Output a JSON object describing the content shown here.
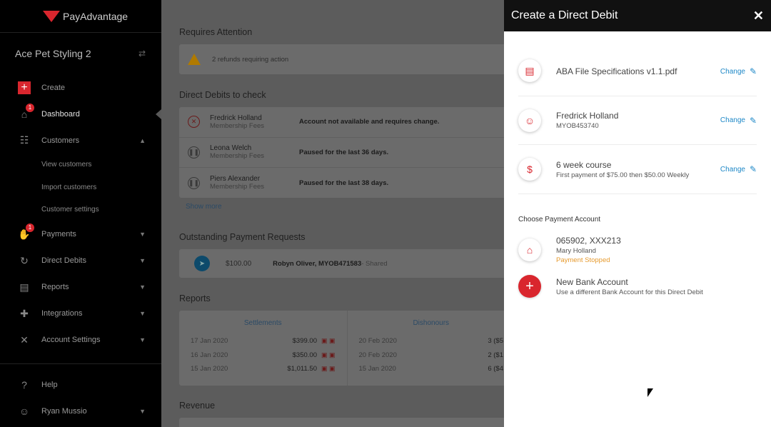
{
  "brand": "PayAdvantage",
  "account_name": "Ace Pet Styling 2",
  "nav": {
    "create": "Create",
    "dashboard": "Dashboard",
    "dashboard_badge": "1",
    "customers": "Customers",
    "customers_sub": [
      "View customers",
      "Import customers",
      "Customer settings"
    ],
    "payments": "Payments",
    "payments_badge": "1",
    "direct_debits": "Direct Debits",
    "reports": "Reports",
    "integrations": "Integrations",
    "account_settings": "Account Settings",
    "help": "Help",
    "user": "Ryan Mussio"
  },
  "main": {
    "requires_attention": "Requires Attention",
    "attention_text": "2 refunds requiring action",
    "dd_check_title": "Direct Debits to check",
    "dd_rows": [
      {
        "name": "Fredrick Holland",
        "plan": "Membership Fees",
        "message": "Account not available and requires change."
      },
      {
        "name": "Leona Welch",
        "plan": "Membership Fees",
        "message": "Paused for the last 36 days."
      },
      {
        "name": "Piers Alexander",
        "plan": "Membership Fees",
        "message": "Paused for the last 38 days."
      }
    ],
    "show_more": "Show more",
    "opr_title": "Outstanding Payment Requests",
    "opr_amount": "$100.00",
    "opr_who": "Robyn Oliver, MYOB471583",
    "opr_shared": " - Shared",
    "reports_title": "Reports",
    "settlements_label": "Settlements",
    "dishonours_label": "Dishonours",
    "settlements": [
      {
        "date": "17 Jan 2020",
        "value": "$399.00"
      },
      {
        "date": "16 Jan 2020",
        "value": "$350.00"
      },
      {
        "date": "15 Jan 2020",
        "value": "$1,011.50"
      }
    ],
    "dishonours": [
      {
        "date": "20 Feb 2020",
        "value": "3 ($5"
      },
      {
        "date": "20 Feb 2020",
        "value": "2 ($1"
      },
      {
        "date": "15 Jan 2020",
        "value": "6 ($4"
      }
    ],
    "revenue_title": "Revenue"
  },
  "panel": {
    "title": "Create a Direct Debit",
    "file_name": "ABA File Specifications v1.1.pdf",
    "customer_name": "Fredrick Holland",
    "customer_id": "MYOB453740",
    "plan_name": "6 week course",
    "plan_desc": "First payment of $75.00 then $50.00 Weekly",
    "change_label": "Change",
    "choose_account": "Choose Payment Account",
    "bank_account": "065902, XXX213",
    "bank_holder": "Mary Holland",
    "bank_status": "Payment Stopped",
    "new_bank_title": "New Bank Account",
    "new_bank_desc": "Use a different Bank Account for this Direct Debit"
  }
}
